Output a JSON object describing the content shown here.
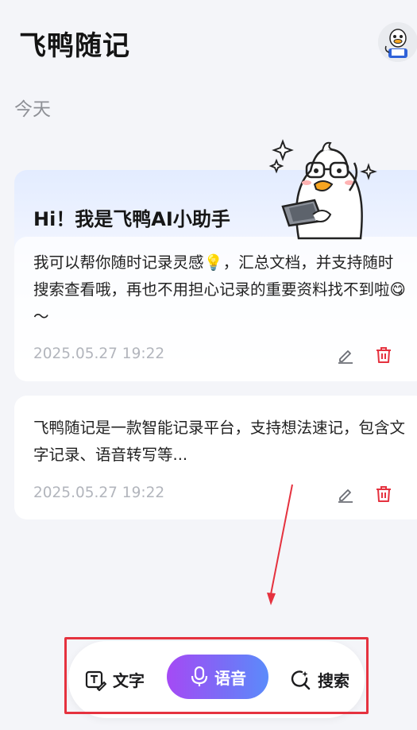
{
  "header": {
    "title": "飞鸭随记",
    "avatar_icon": "duck-avatar-icon"
  },
  "sections": {
    "today_label": "今天"
  },
  "notes": [
    {
      "greeting": "Hi！我是飞鸭AI小助手",
      "content": "我可以帮你随时记录灵感💡，汇总文档，并支持随时搜索查看哦，再也不用担心记录的重要资料找不到啦😋～",
      "timestamp": "2025.05.27 19:22",
      "actions": [
        "edit-icon",
        "trash-icon"
      ]
    },
    {
      "content": "飞鸭随记是一款智能记录平台，支持想法速记，包含文字记录、语音转写等...",
      "timestamp": "2025.05.27 19:22",
      "actions": [
        "edit-icon",
        "trash-icon"
      ]
    }
  ],
  "bottom_bar": {
    "text_label": "文字",
    "voice_label": "语音",
    "search_label": "搜索"
  },
  "colors": {
    "accent_gradient_start": "#a54af5",
    "accent_gradient_end": "#5b8bfb",
    "delete_red": "#e5323f",
    "annotation_red": "#e5323f",
    "timestamp_gray": "#b2b5bc"
  }
}
